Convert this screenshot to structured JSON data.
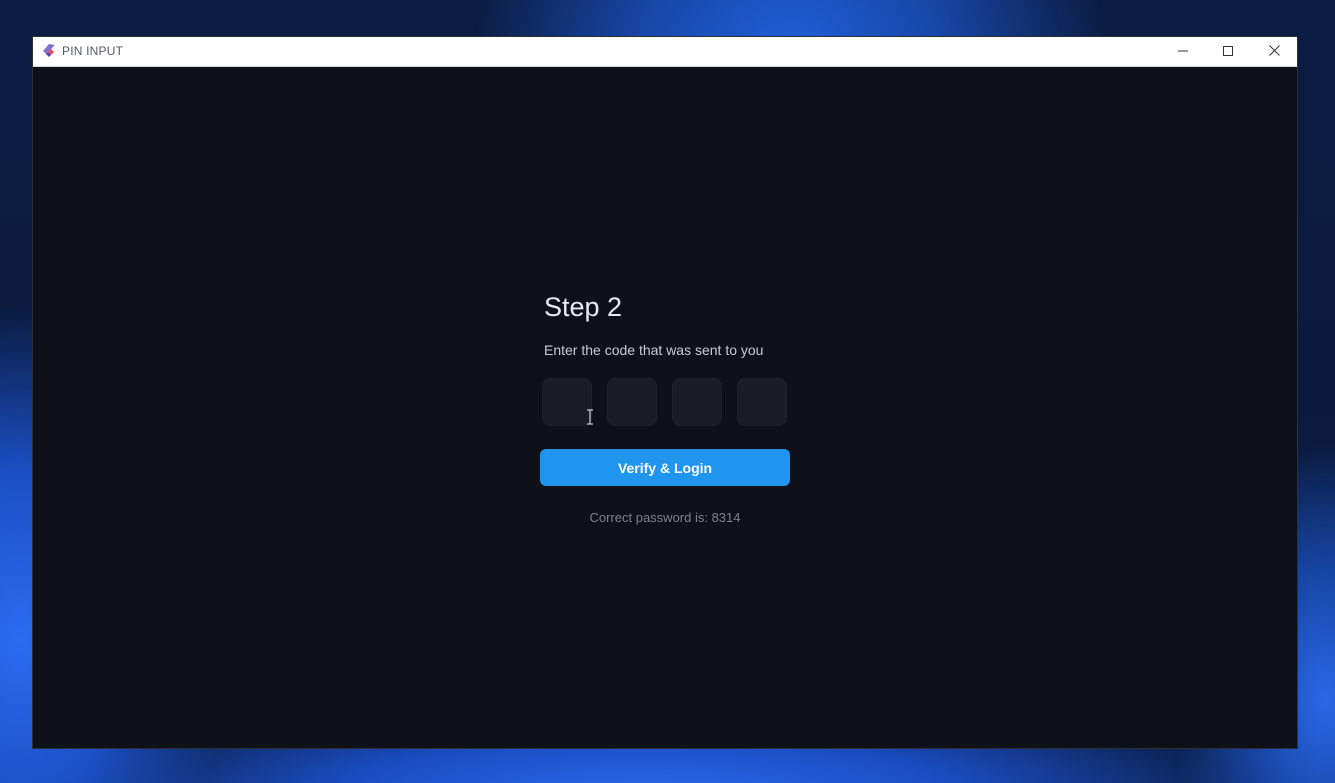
{
  "window": {
    "title": "PIN INPUT",
    "icon": "flutter-logo-icon"
  },
  "title_buttons": {
    "minimize_icon": "minimize-icon",
    "maximize_icon": "maximize-icon",
    "close_icon": "close-icon"
  },
  "form": {
    "heading": "Step 2",
    "subtitle": "Enter the code that was sent to you",
    "pin_digits": [
      "",
      "",
      "",
      ""
    ],
    "submit_label": "Verify & Login",
    "hint": "Correct password is: 8314"
  },
  "colors": {
    "background": "#0f1118",
    "pin_box": "#1a1d26",
    "accent": "#1f95f0",
    "heading": "#e8eaf0",
    "hint": "#7d8190"
  }
}
